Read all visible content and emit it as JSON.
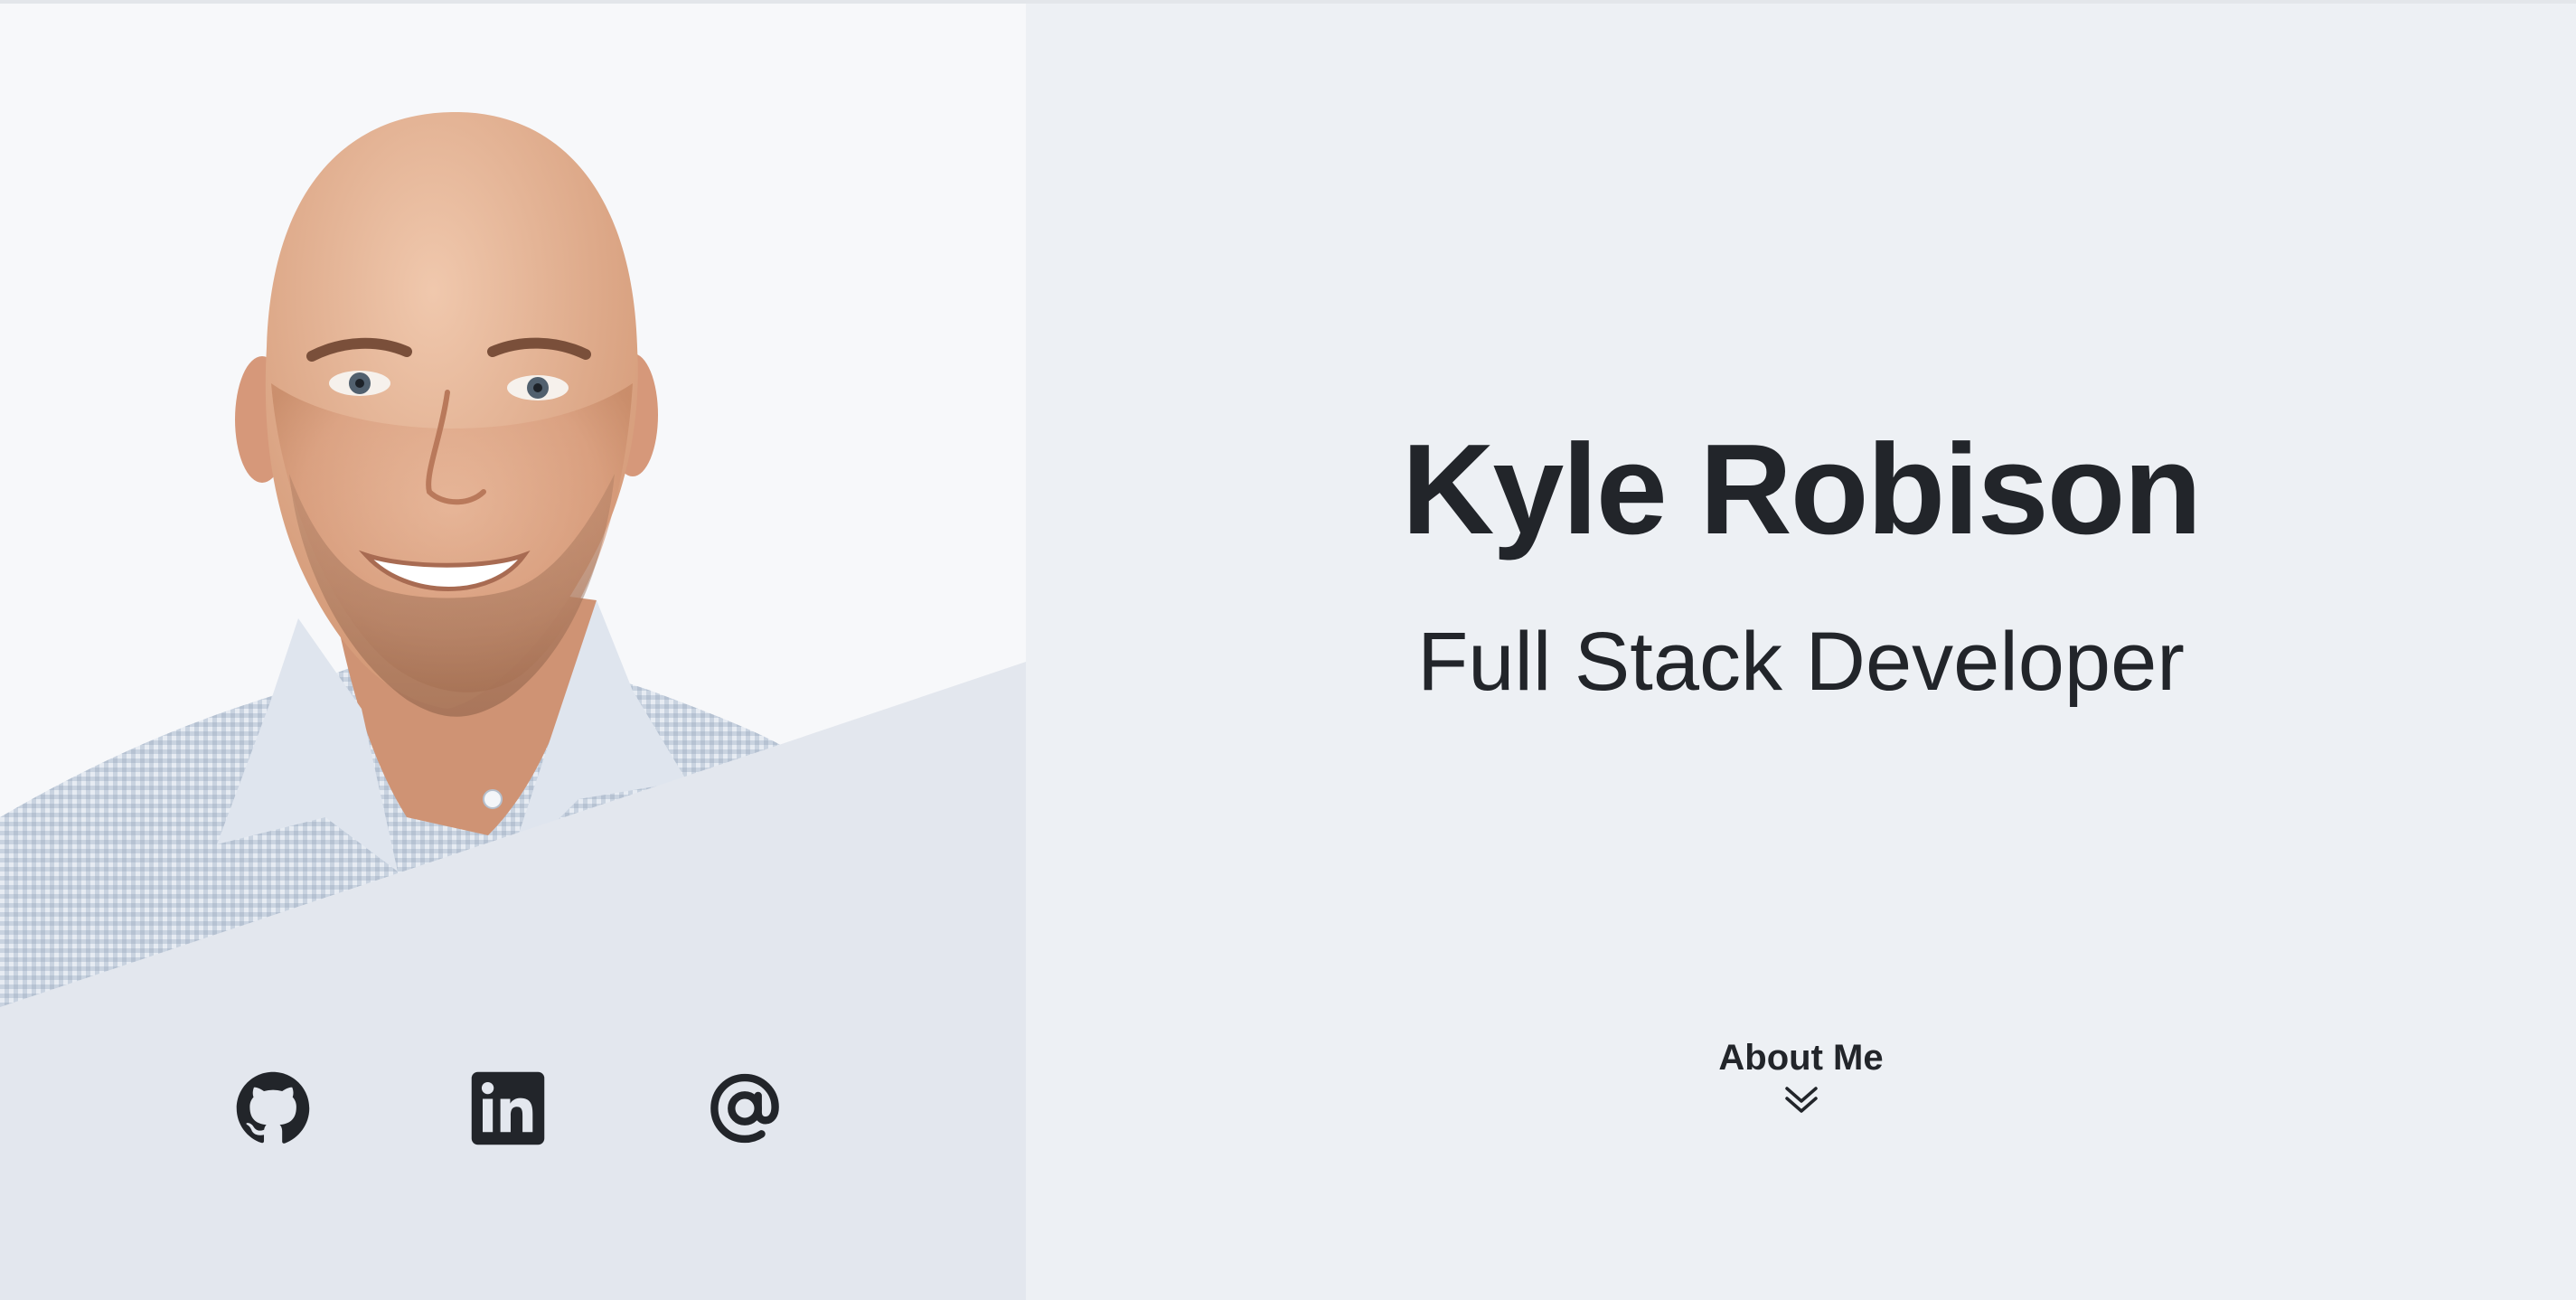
{
  "profile": {
    "name": "Kyle Robison",
    "title": "Full Stack Developer"
  },
  "navigation": {
    "about_label": "About Me"
  },
  "social": [
    {
      "name": "GitHub",
      "icon": "github-icon"
    },
    {
      "name": "LinkedIn",
      "icon": "linkedin-icon"
    },
    {
      "name": "Email",
      "icon": "at-sign-icon"
    }
  ],
  "colors": {
    "text": "#22252a",
    "left_background": "#f7f8fa",
    "right_background": "#edf0f4",
    "social_band": "#e3e7ee"
  }
}
